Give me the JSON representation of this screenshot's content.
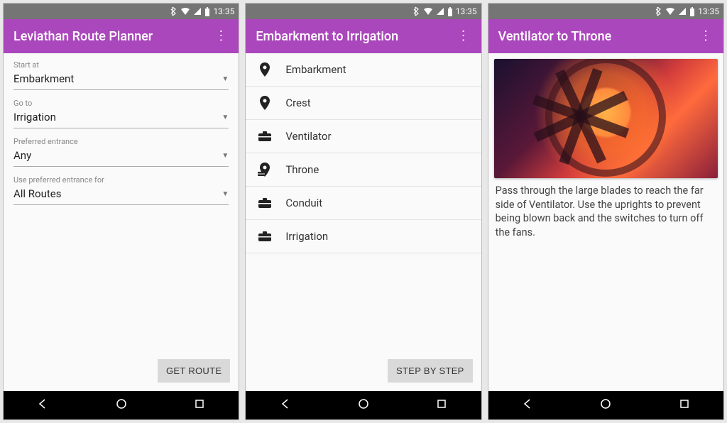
{
  "status": {
    "time": "13:35"
  },
  "screen1": {
    "title": "Leviathan Route Planner",
    "fields": [
      {
        "label": "Start at",
        "value": "Embarkment"
      },
      {
        "label": "Go to",
        "value": "Irrigation"
      },
      {
        "label": "Preferred entrance",
        "value": "Any"
      },
      {
        "label": "Use preferred entrance for",
        "value": "All Routes"
      }
    ],
    "button": "GET ROUTE"
  },
  "screen2": {
    "title": "Embarkment to Irrigation",
    "steps": [
      {
        "icon": "pin",
        "label": "Embarkment"
      },
      {
        "icon": "pin",
        "label": "Crest"
      },
      {
        "icon": "box",
        "label": "Ventilator"
      },
      {
        "icon": "pinbox",
        "label": "Throne"
      },
      {
        "icon": "box",
        "label": "Conduit"
      },
      {
        "icon": "box",
        "label": "Irrigation"
      }
    ],
    "button": "STEP BY STEP"
  },
  "screen3": {
    "title": "Ventilator to Throne",
    "description": "Pass through the large blades to reach the far side of Ventilator. Use the uprights to prevent being blown back and the switches to turn off the fans."
  }
}
